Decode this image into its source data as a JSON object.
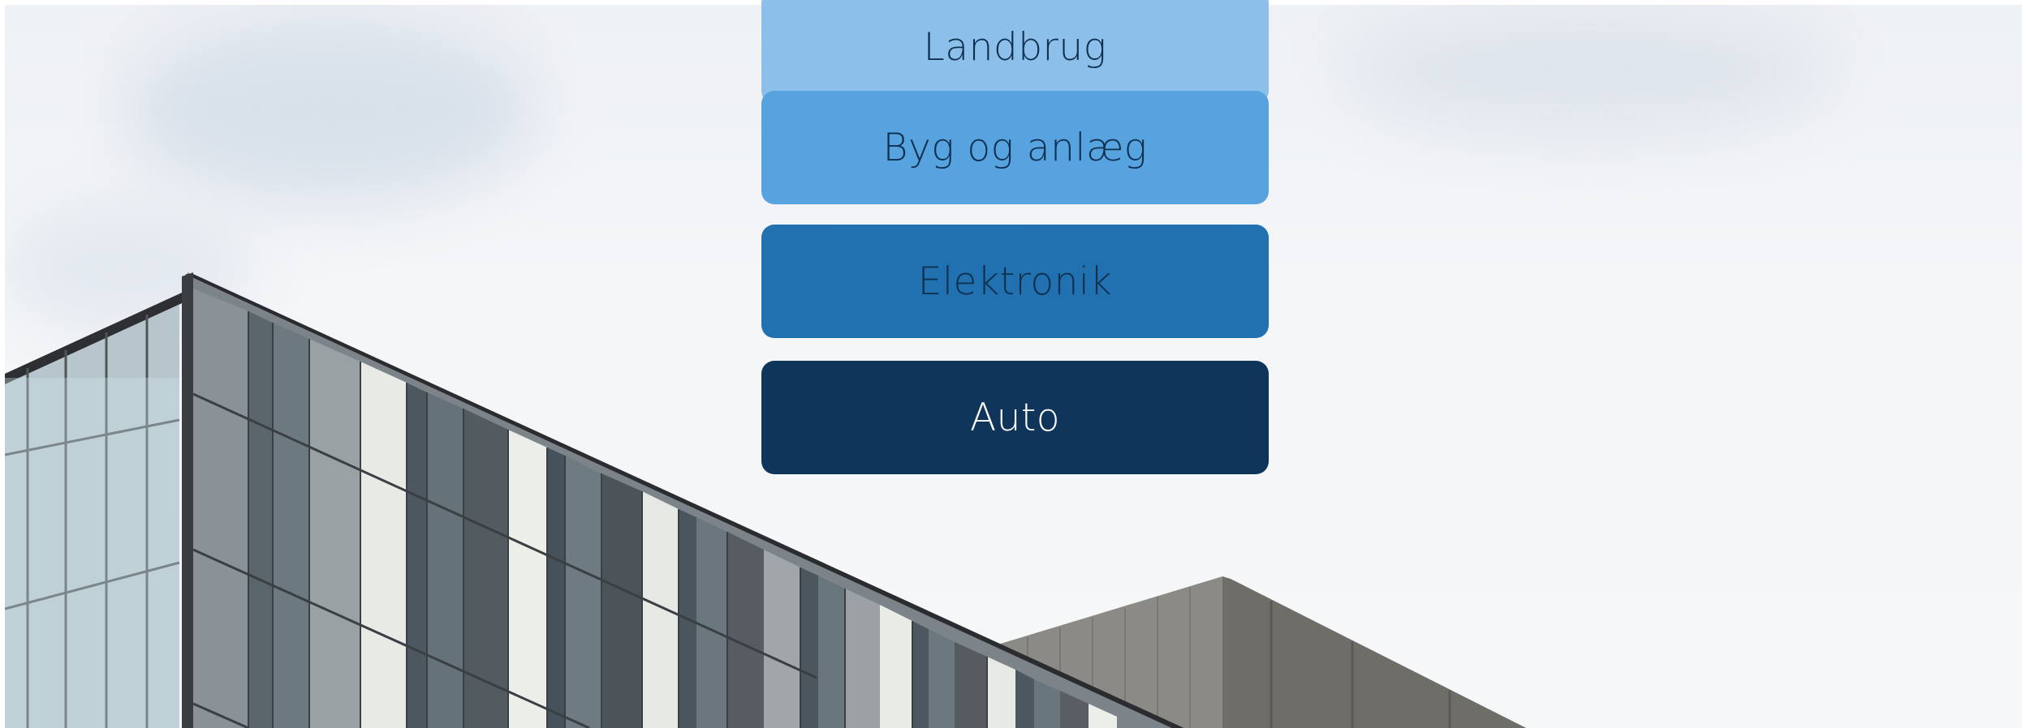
{
  "categories": [
    {
      "label": "Landbrug",
      "bg": "#8cc0ea",
      "fg": "#0f2f4f"
    },
    {
      "label": "Byg og anlæg",
      "bg": "#57a3e0",
      "fg": "#0f2f4f"
    },
    {
      "label": "Elektronik",
      "bg": "#2170af",
      "fg": "#0f2f4f"
    },
    {
      "label": "Auto",
      "bg": "#10355a",
      "fg": "#ffffff"
    }
  ],
  "hero": {
    "icon": "building-photo"
  }
}
